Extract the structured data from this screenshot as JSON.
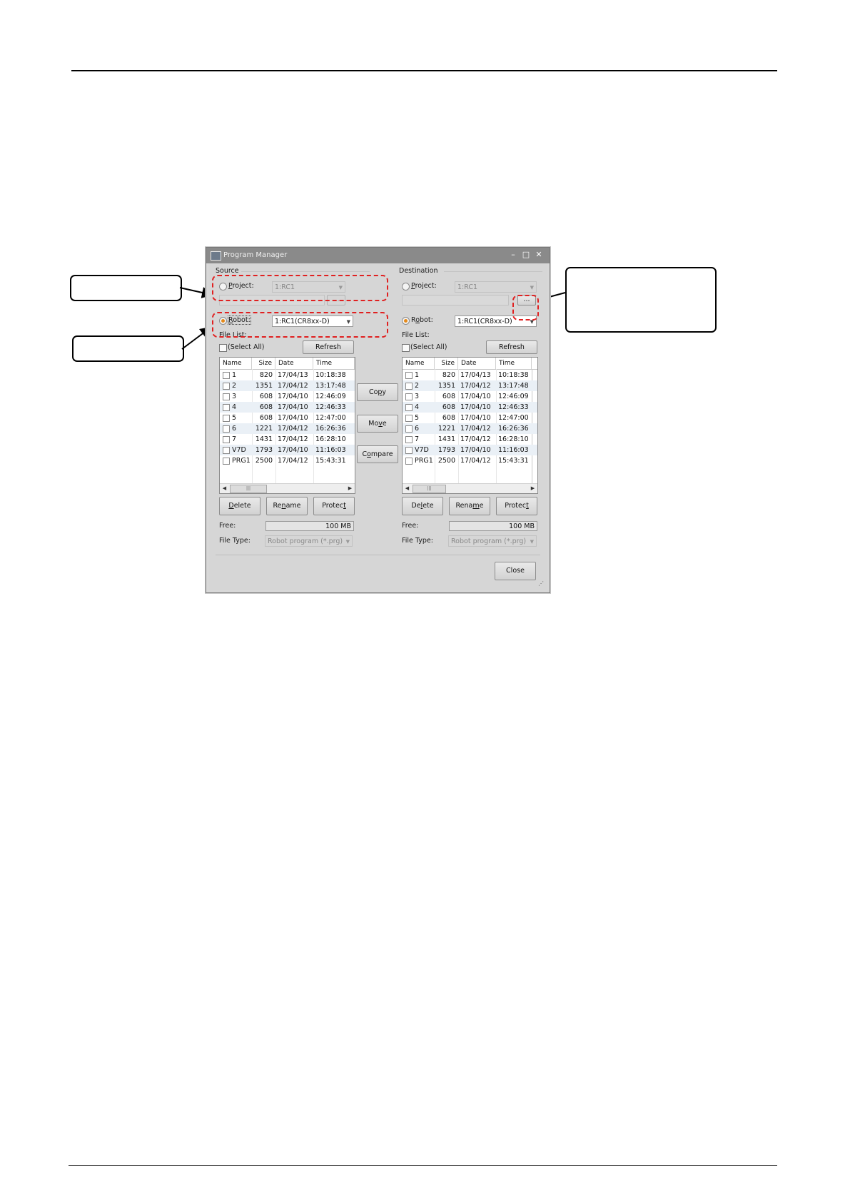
{
  "window": {
    "title": "Program Manager",
    "minimize_glyph": "–",
    "maximize_glyph": "□",
    "close_glyph": "✕"
  },
  "source": {
    "group_label": "Source",
    "project_label": "Project:",
    "project_value": "1:RC1",
    "browse_label": "...",
    "robot_label": "Robot:",
    "robot_value": "1:RC1(CR8xx-D)",
    "file_list_label": "File List:",
    "select_all_label": "(Select All)",
    "refresh_label": "Refresh",
    "delete_label": "Delete",
    "rename_label": "Rename",
    "protect_label": "Protect",
    "free_label": "Free:",
    "free_value": "100 MB",
    "file_type_label": "File Type:",
    "file_type_value": "Robot program (*.prg)"
  },
  "destination": {
    "group_label": "Destination",
    "project_label": "Project:",
    "project_value": "1:RC1",
    "browse_label": "...",
    "robot_label": "Robot:",
    "robot_value": "1:RC1(CR8xx-D)",
    "file_list_label": "File List:",
    "select_all_label": "(Select All)",
    "refresh_label": "Refresh",
    "delete_label": "Delete",
    "rename_label": "Rename",
    "protect_label": "Protect",
    "free_label": "Free:",
    "free_value": "100 MB",
    "file_type_label": "File Type:",
    "file_type_value": "Robot program (*.prg)"
  },
  "columns": [
    "Name",
    "Size",
    "Date",
    "Time"
  ],
  "files": [
    {
      "name": "1",
      "size": "820",
      "date": "17/04/13",
      "time": "10:18:38"
    },
    {
      "name": "2",
      "size": "1351",
      "date": "17/04/12",
      "time": "13:17:48"
    },
    {
      "name": "3",
      "size": "608",
      "date": "17/04/10",
      "time": "12:46:09"
    },
    {
      "name": "4",
      "size": "608",
      "date": "17/04/10",
      "time": "12:46:33"
    },
    {
      "name": "5",
      "size": "608",
      "date": "17/04/10",
      "time": "12:47:00"
    },
    {
      "name": "6",
      "size": "1221",
      "date": "17/04/12",
      "time": "16:26:36"
    },
    {
      "name": "7",
      "size": "1431",
      "date": "17/04/12",
      "time": "16:28:10"
    },
    {
      "name": "V7D",
      "size": "1793",
      "date": "17/04/10",
      "time": "11:16:03"
    },
    {
      "name": "PRG1",
      "size": "2500",
      "date": "17/04/12",
      "time": "15:43:31"
    }
  ],
  "scroll_grip": "|||",
  "middle": {
    "copy_label": "Copy",
    "move_label": "Move",
    "compare_label": "Compare"
  },
  "close_label": "Close",
  "accent_colors": {
    "highlight_dash": "#e02020",
    "radio_selected": "#e58a1a",
    "row_alternate": "#eaf0f6"
  }
}
